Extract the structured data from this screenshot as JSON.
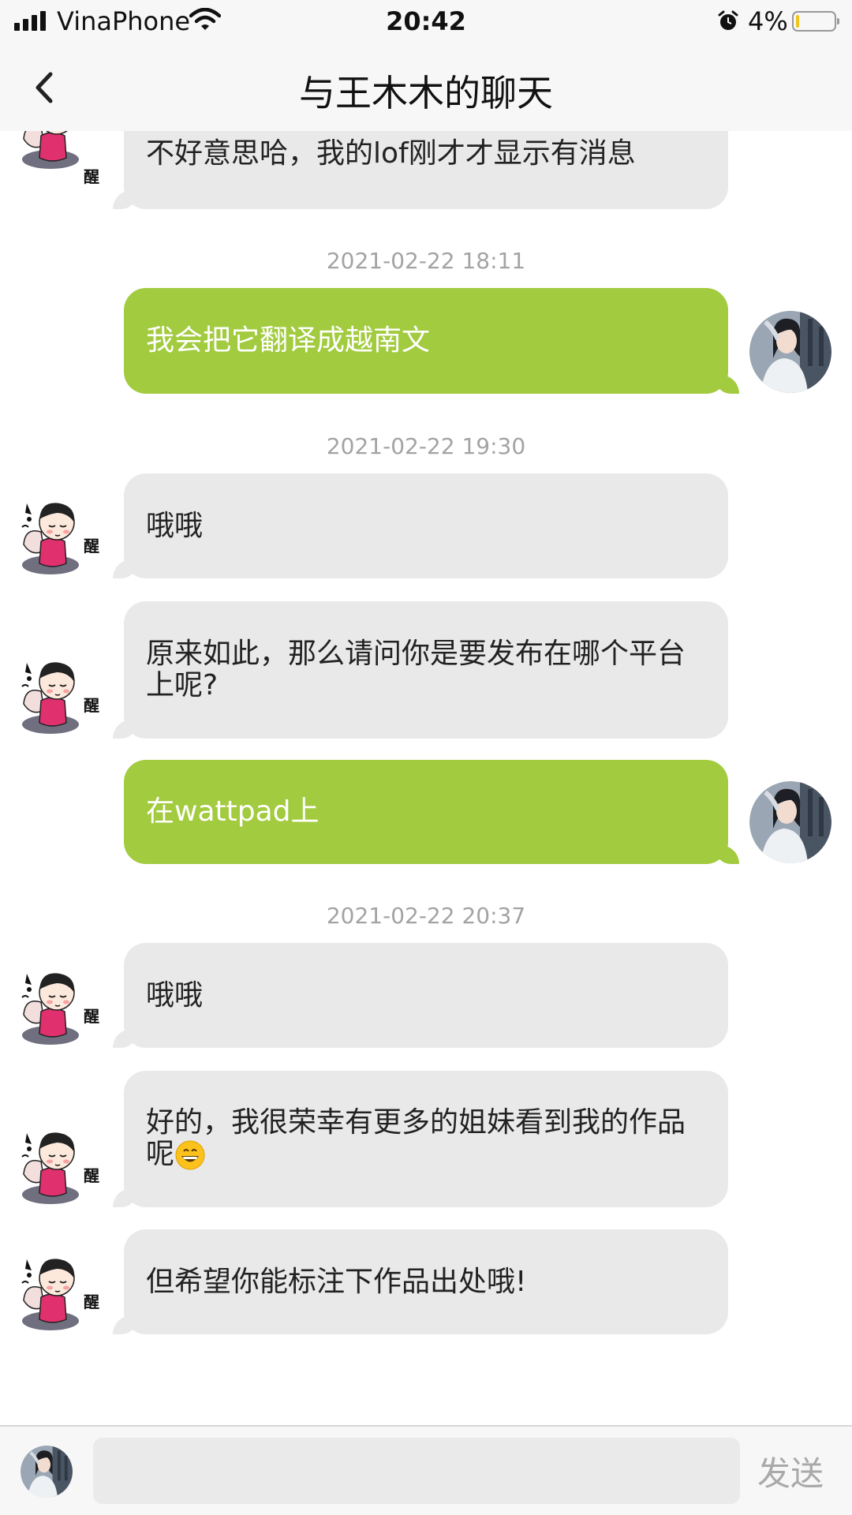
{
  "status_bar": {
    "carrier": "VinaPhone",
    "time": "20:42",
    "battery_percent": "4%",
    "battery_level": 0.04,
    "icons": [
      "signal-icon",
      "wifi-icon",
      "alarm-icon",
      "battery-icon"
    ]
  },
  "header": {
    "title": "与王木木的聊天",
    "back_icon": "chevron-left-icon"
  },
  "messages": [
    {
      "sender": "other",
      "text": "不好意思哈，我的lof刚才才显示有消息"
    },
    {
      "timestamp": "2021-02-22 18:11"
    },
    {
      "sender": "self",
      "text": "我会把它翻译成越南文"
    },
    {
      "timestamp": "2021-02-22 19:30"
    },
    {
      "sender": "other",
      "text": "哦哦"
    },
    {
      "sender": "other",
      "text": "原来如此，那么请问你是要发布在哪个平台上呢?"
    },
    {
      "sender": "self",
      "text": "在wattpad上"
    },
    {
      "timestamp": "2021-02-22 20:37"
    },
    {
      "sender": "other",
      "text": "哦哦"
    },
    {
      "sender": "other",
      "text": "好的，我很荣幸有更多的姐妹看到我的作品呢",
      "emoji": "grinning-face-icon"
    },
    {
      "sender": "other",
      "text": "但希望你能标注下作品出处哦!"
    }
  ],
  "avatars": {
    "other_caption": "醒"
  },
  "input": {
    "placeholder": "",
    "value": "",
    "send_label": "发送"
  },
  "colors": {
    "outgoing_bubble": "#a2cb3f",
    "incoming_bubble": "#e9e9e9",
    "timestamp_text": "#a3a3a3",
    "send_text": "#a9a9a9"
  }
}
